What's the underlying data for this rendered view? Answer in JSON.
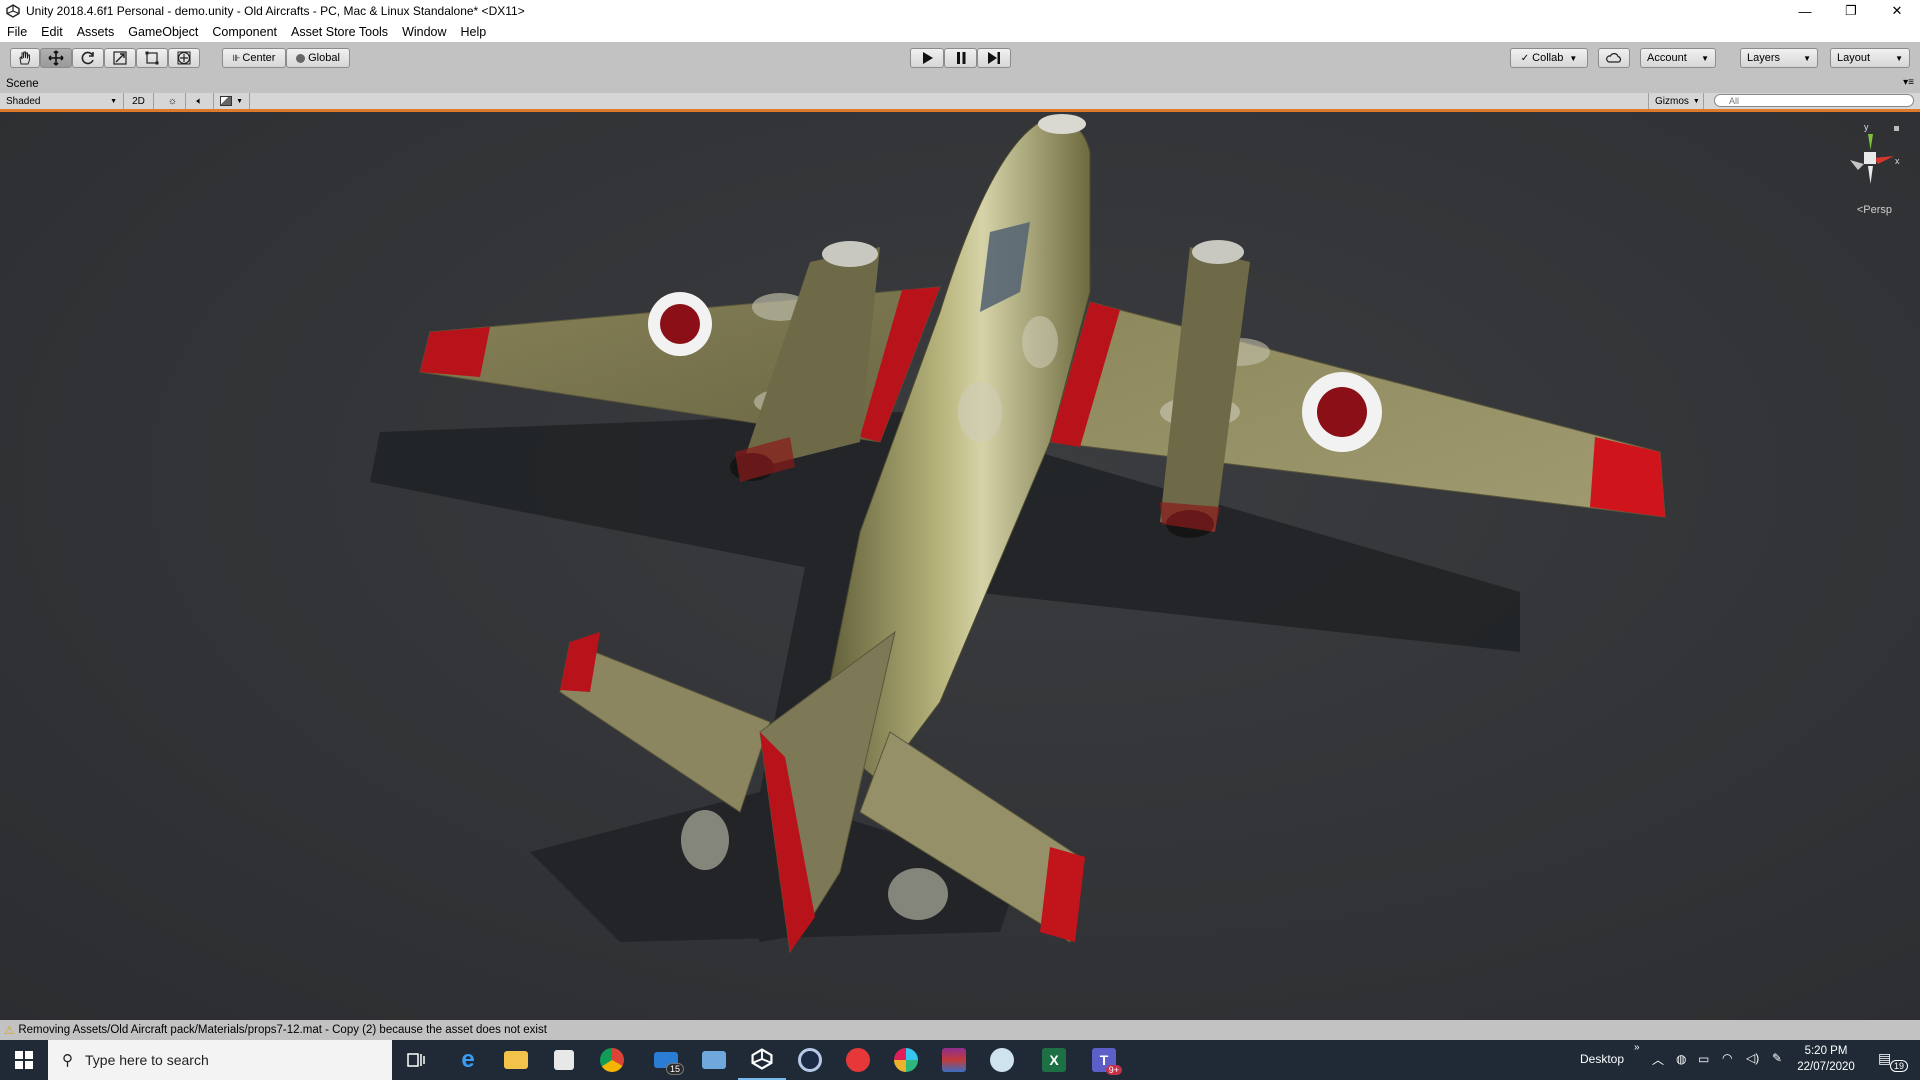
{
  "window": {
    "title": "Unity 2018.4.6f1 Personal - demo.unity - Old Aircrafts - PC, Mac & Linux Standalone* <DX11>",
    "minimize": "—",
    "maximize": "❐",
    "close": "✕"
  },
  "menu": [
    "File",
    "Edit",
    "Assets",
    "GameObject",
    "Component",
    "Asset Store Tools",
    "Window",
    "Help"
  ],
  "toolbar": {
    "tools": [
      {
        "icon": "hand-icon"
      },
      {
        "icon": "move-icon"
      },
      {
        "icon": "rotate-icon"
      },
      {
        "icon": "scale-icon"
      },
      {
        "icon": "rect-icon"
      },
      {
        "icon": "transform-icon"
      }
    ],
    "pivot_label": "Center",
    "space_label": "Global",
    "collab_label": "Collab",
    "account_label": "Account",
    "layers_label": "Layers",
    "layout_label": "Layout"
  },
  "scene": {
    "tab_label": "Scene",
    "shading_mode": "Shaded",
    "mode_2d": "2D",
    "gizmos_label": "Gizmos",
    "search_placeholder": "All",
    "gizmo_y": "y",
    "gizmo_x": "x",
    "projection_label": "Persp"
  },
  "status": {
    "message": "Removing Assets/Old Aircraft pack/Materials/props7-12.mat - Copy (2) because the asset does not exist"
  },
  "taskbar": {
    "search_placeholder": "Type here to search",
    "mail_badge": "15",
    "teams_badge": "9+",
    "desktop_label": "Desktop",
    "time": "5:20 PM",
    "date": "22/07/2020",
    "notifications_badge": "19"
  },
  "colors": {
    "accent_orange": "#e07a2a",
    "viewport_bg": "#333538",
    "taskbar_bg": "#1f2a36"
  }
}
